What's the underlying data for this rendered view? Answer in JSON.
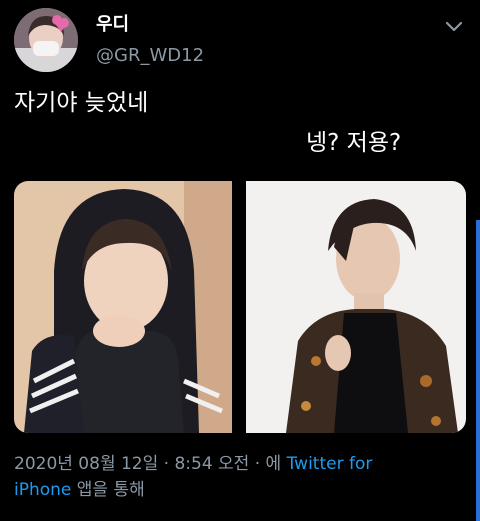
{
  "tweet": {
    "display_name": "우디",
    "handle": "@GR_WD12",
    "text_line1": "자기야 늦었네",
    "text_line2": "넹? 저용?",
    "timestamp": "2020년 08월 12일 · 8:54 오전 · 에",
    "client_link_line1": "Twitter for",
    "client_link_line2": "iPhone",
    "client_suffix": "앱을 통해"
  },
  "icons": {
    "more": "chevron-down-icon"
  },
  "colors": {
    "background": "#000000",
    "text_primary": "#ffffff",
    "text_secondary": "#8b98a5",
    "link": "#1d9bf0"
  }
}
